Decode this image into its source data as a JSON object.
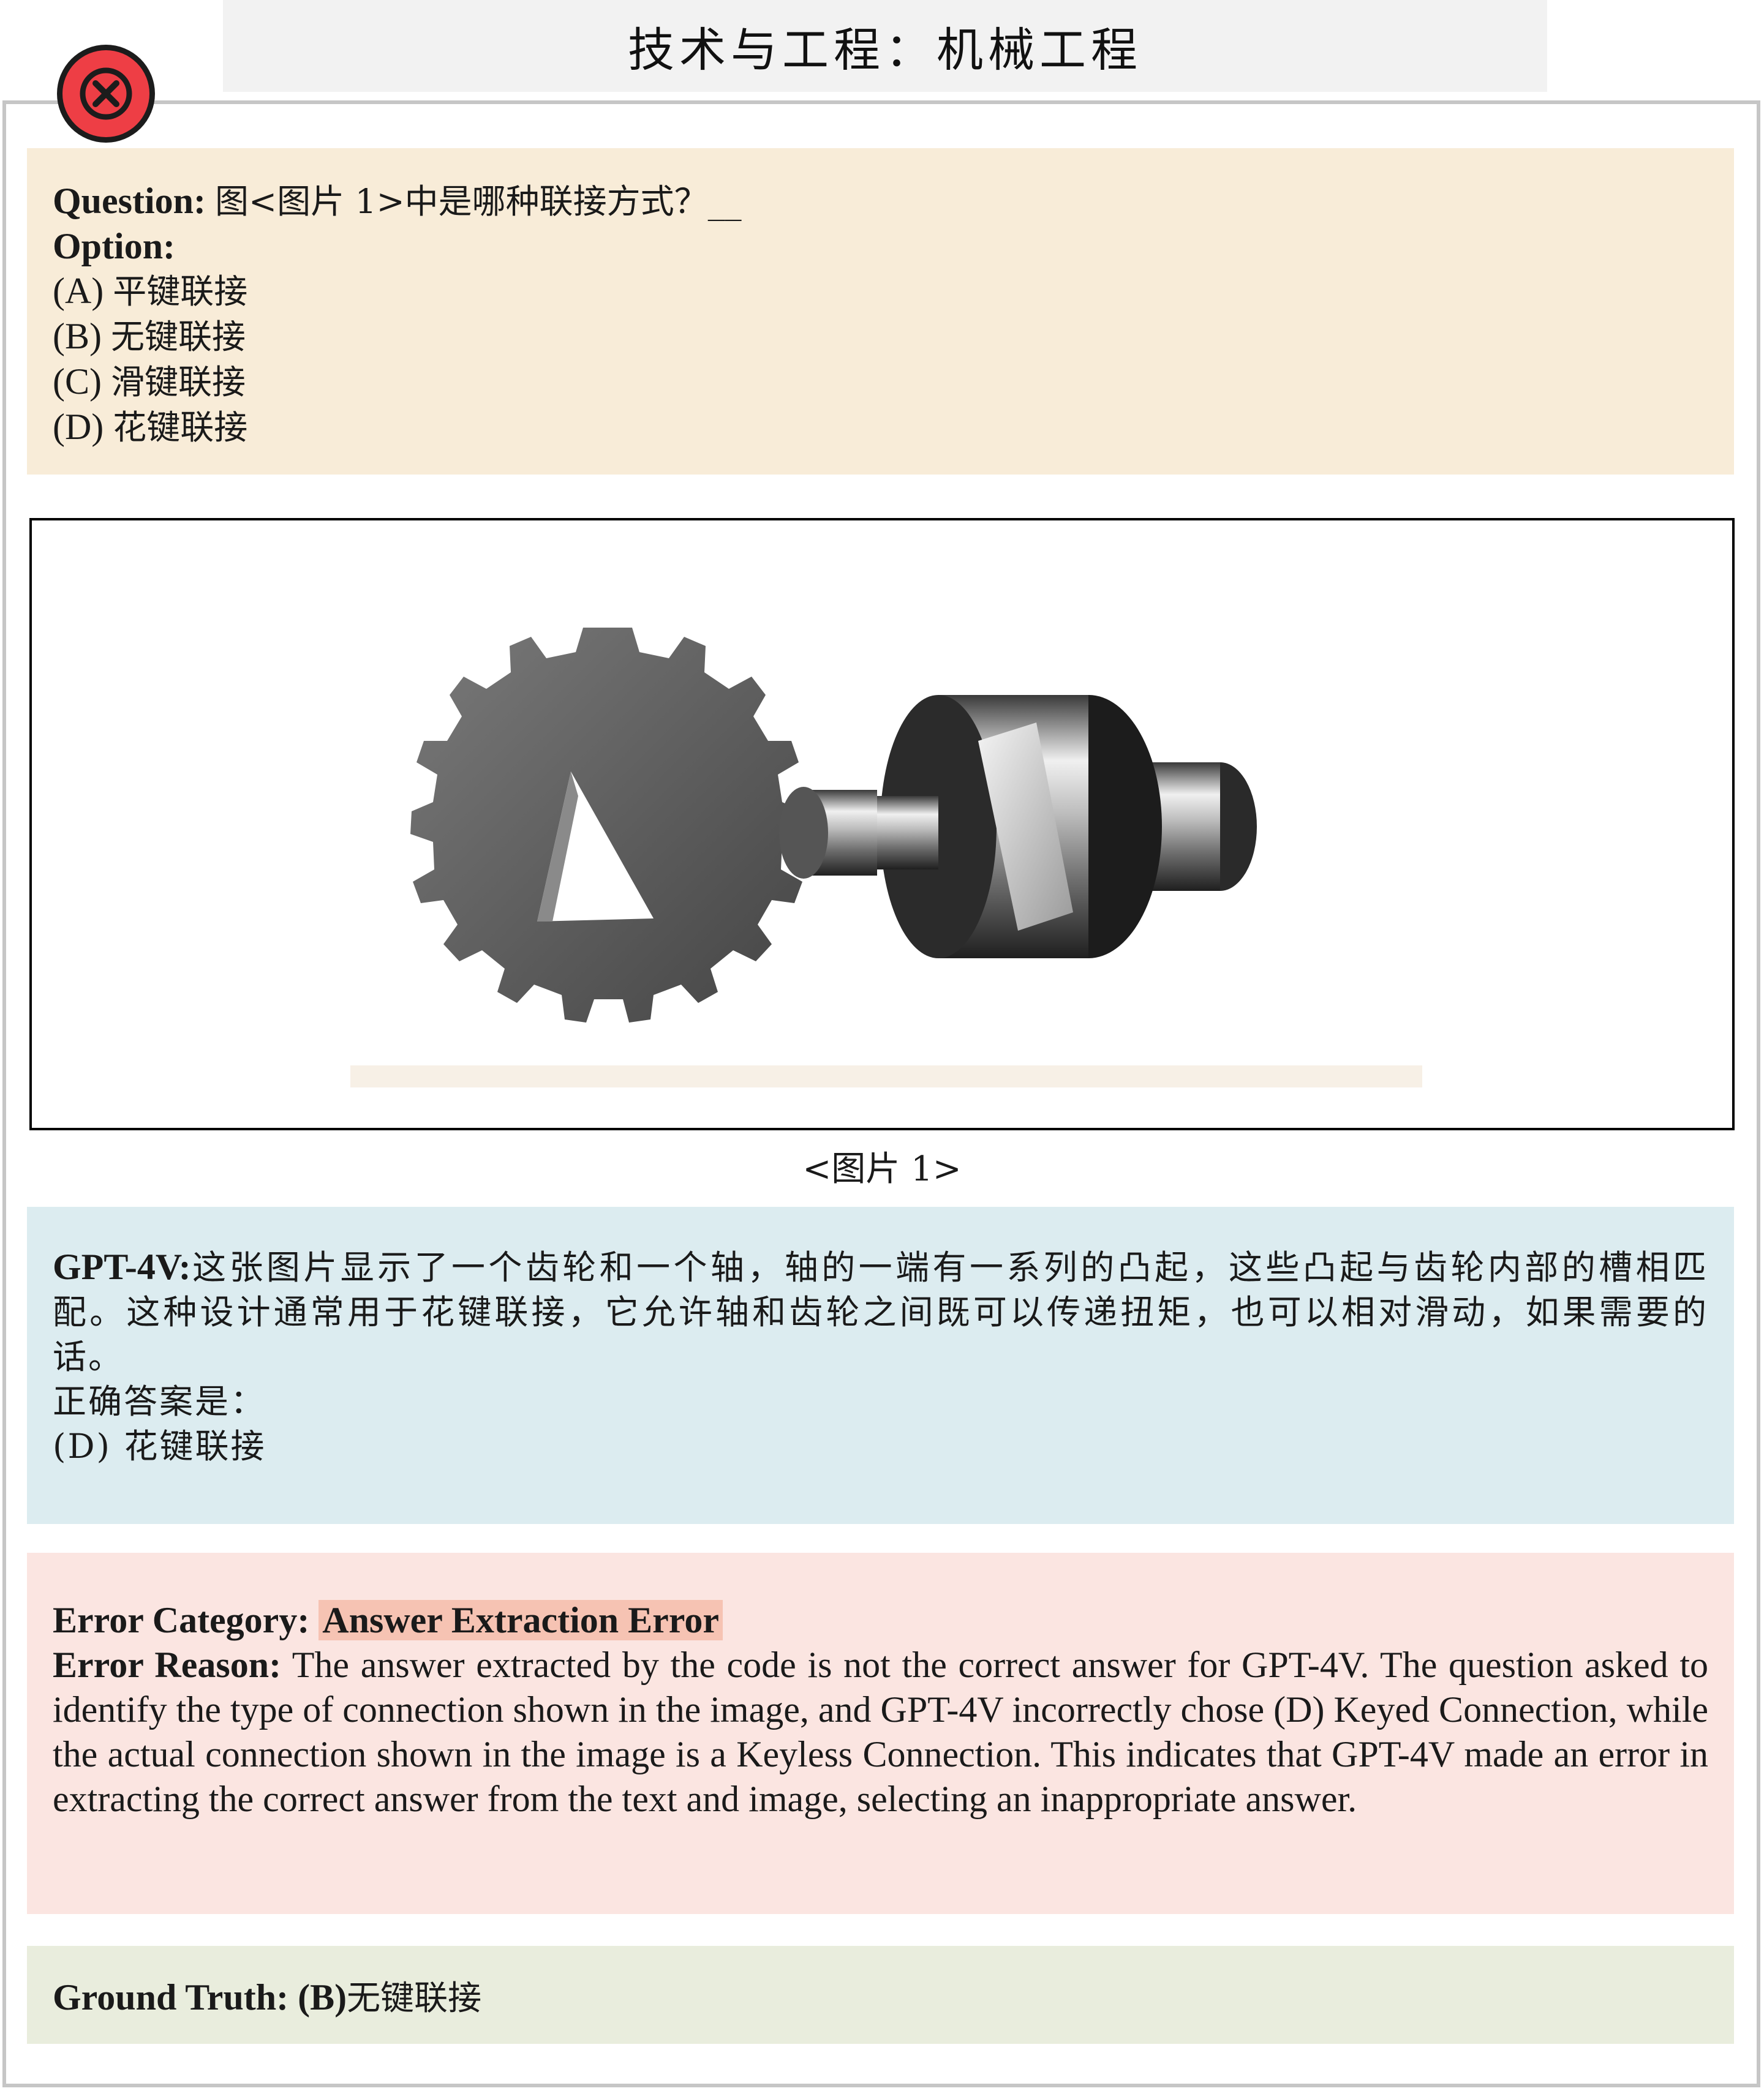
{
  "header": {
    "title": "技术与工程：机械工程"
  },
  "question": {
    "label": "Question:",
    "text": "图<图片 1>中是哪种联接方式？__",
    "option_label": "Option:",
    "options": [
      {
        "key": "(A)",
        "text": "平键联接"
      },
      {
        "key": "(B)",
        "text": "无键联接"
      },
      {
        "key": "(C)",
        "text": "滑键联接"
      },
      {
        "key": "(D)",
        "text": "花键联接"
      }
    ]
  },
  "figure": {
    "caption": "<图片 1>"
  },
  "gpt": {
    "label": "GPT-4V:",
    "text": "这张图片显示了一个齿轮和一个轴，轴的一端有一系列的凸起，这些凸起与齿轮内部的槽相匹配。这种设计通常用于花键联接，它允许轴和齿轮之间既可以传递扭矩，也可以相对滑动，如果需要的话。",
    "answer_intro": "正确答案是：",
    "answer": "(D) 花键联接"
  },
  "error": {
    "category_label": "Error Category:",
    "category": "Answer Extraction Error",
    "reason_label": "Error Reason:",
    "reason": "The answer extracted by the code is not the correct answer for GPT-4V. The question asked to identify the type of connection shown in the image, and GPT-4V incorrectly chose (D) Keyed Connection, while the actual connection shown in the image is a Keyless Connection. This indicates that GPT-4V made an error in extracting the correct answer from the text and image, selecting an inappropriate answer."
  },
  "ground_truth": {
    "label": "Ground Truth: (B)",
    "text": "无键联接"
  },
  "colors": {
    "question_bg": "#f8ecd8",
    "gpt_bg": "#dcecf0",
    "error_bg": "#fbe5e1",
    "ground_truth_bg": "#e9eddd",
    "error_icon": "#ee3e45"
  },
  "icons": {
    "status": "error-x-icon"
  }
}
